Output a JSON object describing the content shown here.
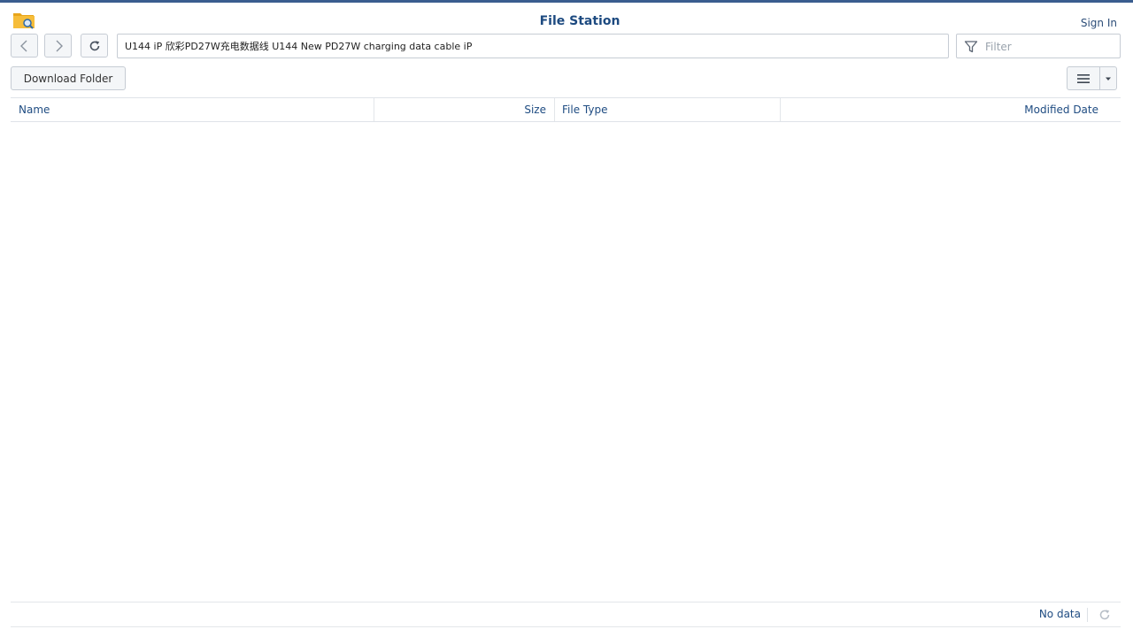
{
  "app": {
    "title": "File Station",
    "sign_in_label": "Sign In",
    "accent_color": "#3a5d8f",
    "title_color": "#1d4a80"
  },
  "toolbar": {
    "back_icon": "chevron-left-icon",
    "forward_icon": "chevron-right-icon",
    "refresh_icon": "refresh-icon",
    "path_value": "U144 iP 欣彩PD27W充电数据线 U144 New PD27W charging data cable iP",
    "filter_placeholder": "Filter",
    "filter_icon": "funnel-icon"
  },
  "actions": {
    "download_folder_label": "Download Folder",
    "view_list_icon": "list-view-icon",
    "view_dropdown_icon": "caret-down-icon"
  },
  "grid": {
    "columns": [
      "Name",
      "Size",
      "File Type",
      "Modified Date"
    ],
    "rows": []
  },
  "status": {
    "text": "No data",
    "refresh_icon": "refresh-icon"
  }
}
